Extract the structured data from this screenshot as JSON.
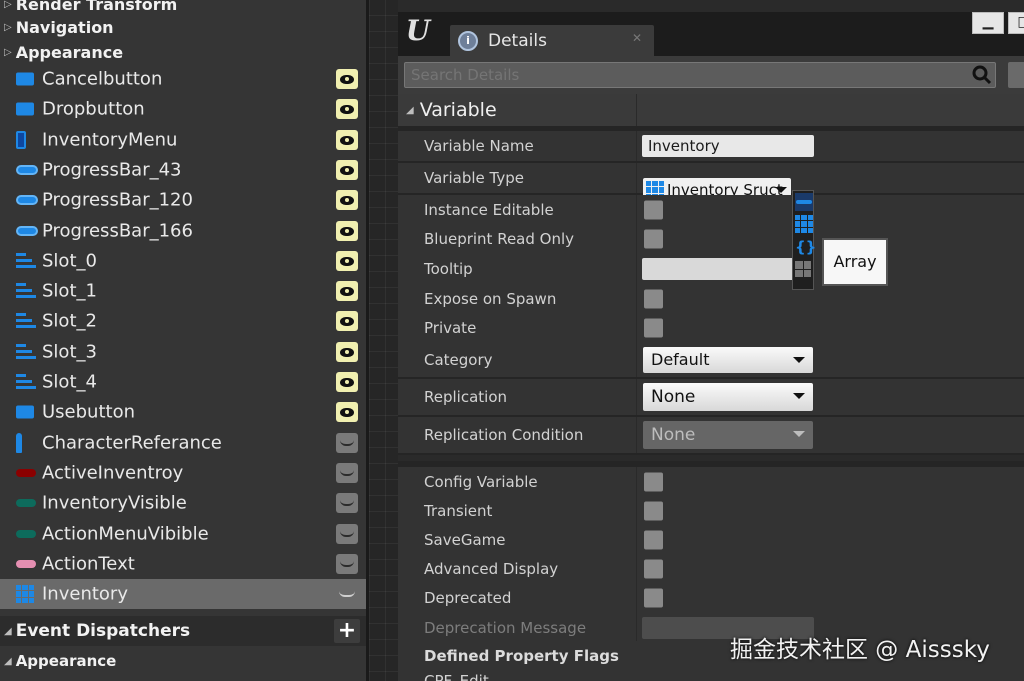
{
  "left_panel": {
    "headers": {
      "render_transform": "Render Transform",
      "navigation": "Navigation",
      "appearance_top": "Appearance",
      "event_dispatchers": "Event Dispatchers",
      "appearance_bottom": "Appearance"
    },
    "variables": [
      {
        "label": "Cancelbutton",
        "icon": "button-icon",
        "visibility": "visible"
      },
      {
        "label": "Dropbutton",
        "icon": "button-icon",
        "visibility": "visible"
      },
      {
        "label": "InventoryMenu",
        "icon": "vertical-box-icon",
        "visibility": "visible"
      },
      {
        "label": "ProgressBar_43",
        "icon": "progress-bar-icon",
        "visibility": "visible"
      },
      {
        "label": "ProgressBar_120",
        "icon": "progress-bar-icon",
        "visibility": "visible"
      },
      {
        "label": "ProgressBar_166",
        "icon": "progress-bar-icon",
        "visibility": "visible"
      },
      {
        "label": "Slot_0",
        "icon": "slot-icon",
        "visibility": "visible"
      },
      {
        "label": "Slot_1",
        "icon": "slot-icon",
        "visibility": "visible"
      },
      {
        "label": "Slot_2",
        "icon": "slot-icon",
        "visibility": "visible"
      },
      {
        "label": "Slot_3",
        "icon": "slot-icon",
        "visibility": "visible"
      },
      {
        "label": "Slot_4",
        "icon": "slot-icon",
        "visibility": "visible"
      },
      {
        "label": "Usebutton",
        "icon": "button-icon",
        "visibility": "visible"
      },
      {
        "label": "CharacterReferance",
        "icon": "character-icon",
        "visibility": "hidden"
      },
      {
        "label": "ActiveInventroy",
        "icon": "bool-red-icon",
        "visibility": "hidden"
      },
      {
        "label": "InventoryVisible",
        "icon": "bool-teal-icon",
        "visibility": "hidden"
      },
      {
        "label": "ActionMenuVibible",
        "icon": "bool-teal-icon",
        "visibility": "hidden"
      },
      {
        "label": "ActionText",
        "icon": "text-icon",
        "visibility": "hidden"
      },
      {
        "label": "Inventory",
        "icon": "array-grid-icon",
        "visibility": "hidden",
        "selected": true
      }
    ],
    "add_button": "+"
  },
  "details": {
    "tab_label": "Details",
    "search_placeholder": "Search Details",
    "section_variable": "Variable",
    "properties": {
      "variable_name_label": "Variable Name",
      "variable_name_value": "Inventory",
      "variable_type_label": "Variable Type",
      "variable_type_value": "Inventory Sruct",
      "instance_editable": "Instance Editable",
      "blueprint_read_only": "Blueprint Read Only",
      "tooltip": "Tooltip",
      "expose_on_spawn": "Expose on Spawn",
      "private": "Private",
      "category_label": "Category",
      "category_value": "Default",
      "replication_label": "Replication",
      "replication_value": "None",
      "replication_condition_label": "Replication Condition",
      "replication_condition_value": "None",
      "config_variable": "Config Variable",
      "transient": "Transient",
      "save_game": "SaveGame",
      "advanced_display": "Advanced Display",
      "deprecated": "Deprecated",
      "deprecation_message": "Deprecation Message",
      "defined_property_flags": "Defined Property Flags",
      "cpf_edit": "CPF_Edit"
    },
    "array_tooltip": "Array"
  },
  "watermark": "掘金技术社区 @ Aisssky",
  "colors": {
    "accent_blue": "#1e88e5",
    "eye_visible": "#f0efb0",
    "panel_bg": "#353535",
    "details_bg": "#252525"
  }
}
